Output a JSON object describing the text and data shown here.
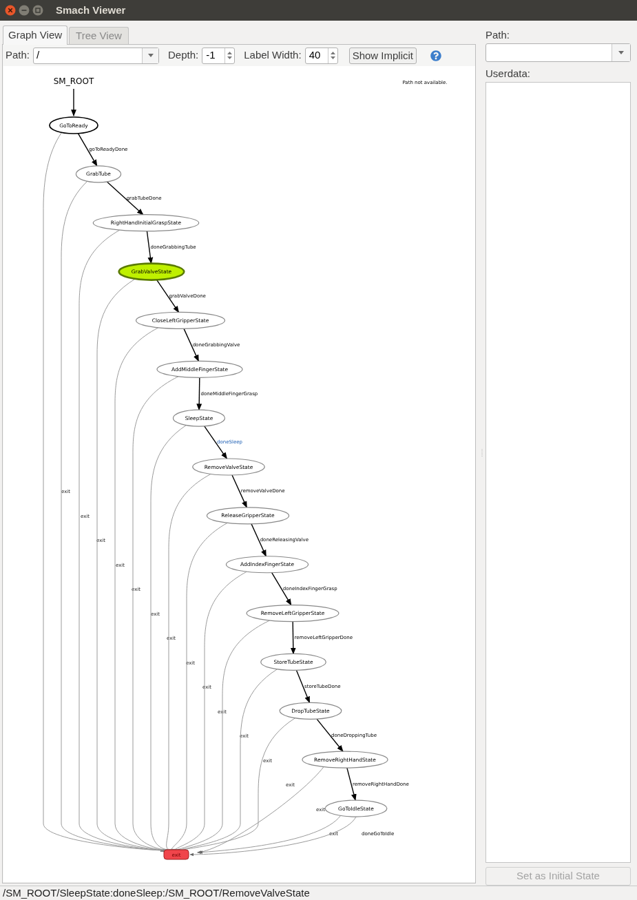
{
  "window": {
    "title": "Smach Viewer"
  },
  "tabs": [
    {
      "label": "Graph View",
      "selected": true
    },
    {
      "label": "Tree View",
      "selected": false
    }
  ],
  "toolbar": {
    "path_label": "Path:",
    "path_value": "/",
    "depth_label": "Depth:",
    "depth_value": "-1",
    "label_width_label": "Label Width:",
    "label_width_value": "40",
    "show_implicit": "Show Implicit"
  },
  "graph": {
    "root": "SM_ROOT",
    "message": "Path not available.",
    "outcome": "exit",
    "states": [
      {
        "name": "GoToReady",
        "initial": true,
        "active": false,
        "transition": "goToReadyDone",
        "highlighted": false,
        "exit_label": "exit"
      },
      {
        "name": "GrabTube",
        "initial": false,
        "active": false,
        "transition": "grabTubeDone",
        "highlighted": false,
        "exit_label": "exit"
      },
      {
        "name": "RightHandInitialGraspState",
        "initial": false,
        "active": false,
        "transition": "doneGrabbingTube",
        "highlighted": false,
        "exit_label": "exit"
      },
      {
        "name": "GrabValveState",
        "initial": false,
        "active": true,
        "transition": "grabValveDone",
        "highlighted": false,
        "exit_label": "exit"
      },
      {
        "name": "CloseLeftGripperState",
        "initial": false,
        "active": false,
        "transition": "doneGrabbingValve",
        "highlighted": false,
        "exit_label": "exit"
      },
      {
        "name": "AddMiddleFingerState",
        "initial": false,
        "active": false,
        "transition": "doneMiddleFingerGrasp",
        "highlighted": false,
        "exit_label": "exit"
      },
      {
        "name": "SleepState",
        "initial": false,
        "active": false,
        "transition": "doneSleep",
        "highlighted": true,
        "exit_label": "exit"
      },
      {
        "name": "RemoveValveState",
        "initial": false,
        "active": false,
        "transition": "removeValveDone",
        "highlighted": false,
        "exit_label": "exit"
      },
      {
        "name": "ReleaseGripperState",
        "initial": false,
        "active": false,
        "transition": "doneReleasingValve",
        "highlighted": false,
        "exit_label": "exit"
      },
      {
        "name": "AddIndexFingerState",
        "initial": false,
        "active": false,
        "transition": "doneIndexFingerGrasp",
        "highlighted": false,
        "exit_label": "exit"
      },
      {
        "name": "RemoveLeftGripperState",
        "initial": false,
        "active": false,
        "transition": "removeLeftGripperDone",
        "highlighted": false,
        "exit_label": "exit"
      },
      {
        "name": "StoreTubeState",
        "initial": false,
        "active": false,
        "transition": "storeTubeDone",
        "highlighted": false,
        "exit_label": "exit"
      },
      {
        "name": "DropTubeState",
        "initial": false,
        "active": false,
        "transition": "doneDroppingTube",
        "highlighted": false,
        "exit_label": "exit"
      },
      {
        "name": "RemoveRightHandState",
        "initial": false,
        "active": false,
        "transition": "removeRightHandDone",
        "highlighted": false,
        "exit_label": "exit"
      },
      {
        "name": "GoToIdleState",
        "initial": false,
        "active": false,
        "transition": "doneGoToIdle",
        "highlighted": false,
        "exit_label": "exit"
      }
    ]
  },
  "side_panel": {
    "path_label": "Path:",
    "userdata_label": "Userdata:",
    "set_initial_state": {
      "label": "Set as Initial State",
      "disabled": true
    }
  },
  "status_bar": "/SM_ROOT/SleepState:doneSleep:/SM_ROOT/RemoveValveState"
}
